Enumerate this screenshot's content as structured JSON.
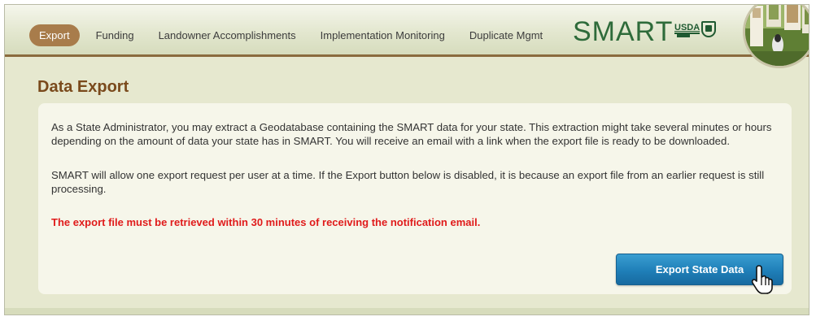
{
  "nav": {
    "tabs": [
      {
        "label": "Export",
        "active": true
      },
      {
        "label": "Funding",
        "active": false
      },
      {
        "label": "Landowner Accomplishments",
        "active": false
      },
      {
        "label": "Implementation Monitoring",
        "active": false
      },
      {
        "label": "Duplicate Mgmt",
        "active": false
      }
    ],
    "brand": "SMART",
    "usda_label": "USDA",
    "logos": [
      "usda-logo",
      "fws-shield-icon"
    ]
  },
  "page": {
    "title": "Data Export",
    "paragraph_1": "As a State Administrator, you may extract a Geodatabase containing the SMART data for your state. This extraction might take several minutes or hours depending on the amount of data your state has in SMART. You will receive an email with a link when the export file is ready to be downloaded.",
    "paragraph_2": "SMART will allow one export request per user at a time. If the Export button below is disabled, it is because an export file from an earlier request is still processing.",
    "warning": "The export file must be retrieved within 30 minutes of receiving the notification email.",
    "export_button_label": "Export State Data"
  },
  "colors": {
    "frame_bg": "#e6e8cf",
    "panel_bg": "#f6f6ea",
    "active_tab": "#a87c4b",
    "title": "#7a4a1c",
    "brand": "#2e6b3a",
    "warning": "#e01b1b",
    "button": "#1f7fb8"
  },
  "icons": [
    "hand-pointer-cursor-icon"
  ]
}
